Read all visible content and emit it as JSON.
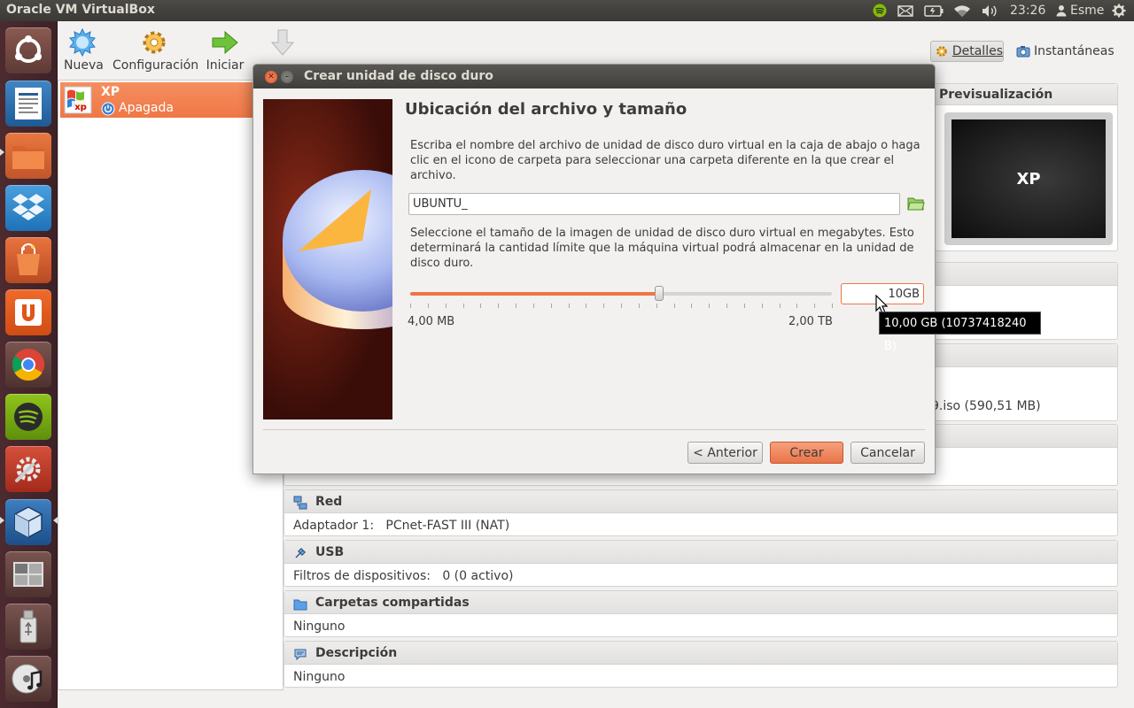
{
  "topbar": {
    "app_title": "Oracle VM VirtualBox",
    "clock": "23:26",
    "user": "Esme",
    "icons": [
      "spotify-icon",
      "mail-icon",
      "battery-icon",
      "wifi-icon",
      "volume-icon",
      "power-icon"
    ]
  },
  "toolbar": {
    "new_label": "Nueva",
    "settings_label": "Configuración",
    "start_label": "Iniciar"
  },
  "tabs": {
    "details_label": "Detalles",
    "snapshots_label": "Instantáneas"
  },
  "vm_list": {
    "items": [
      {
        "name": "XP",
        "state": "Apagada"
      }
    ]
  },
  "preview": {
    "title": "Previsualización",
    "screen_text": "XP"
  },
  "sections": {
    "storage_partial": {
      "body_tail": "9.iso (590,51 MB)"
    },
    "network": {
      "title": "Red",
      "row_label": "Adaptador 1:",
      "row_value": "PCnet-FAST III (NAT)"
    },
    "usb": {
      "title": "USB",
      "row_label": "Filtros de dispositivos:",
      "row_value": "0 (0 activo)"
    },
    "shared": {
      "title": "Carpetas compartidas",
      "row_value": "Ninguno"
    },
    "description": {
      "title": "Descripción",
      "row_value": "Ninguno"
    }
  },
  "dialog": {
    "title": "Crear unidad de disco duro",
    "heading": "Ubicación del archivo y tamaño",
    "text1": "Escriba el nombre del archivo de unidad de disco duro virtual en la caja de abajo o haga clic en el icono de carpeta para seleccionar una carpeta diferente en la que crear el archivo.",
    "file_name": "UBUNTU_",
    "text2": "Seleccione el tamaño de la imagen de unidad de disco duro virtual en megabytes. Esto determinará la cantidad límite que la máquina virtual podrá almacenar en la unidad de disco duro.",
    "slider_fraction": 0.59,
    "min_label": "4,00 MB",
    "max_label": "2,00 TB",
    "size_value": "10GB",
    "tooltip": "10,00 GB (10737418240 B)",
    "back_label": "< Anterior",
    "create_label": "Crear",
    "cancel_label": "Cancelar"
  },
  "colors": {
    "accent": "#ef7545",
    "topbar": "#3c3b37",
    "launcher": "#45262b"
  }
}
